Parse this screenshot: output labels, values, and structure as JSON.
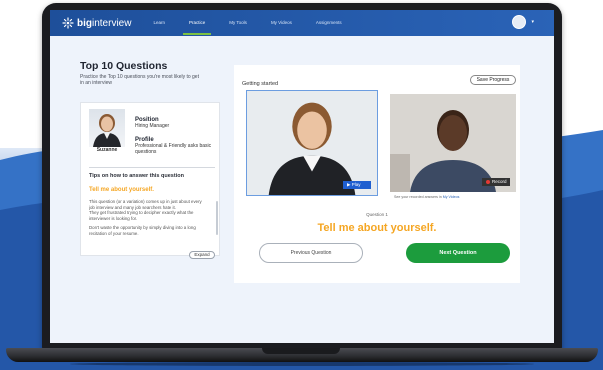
{
  "brand": {
    "logo_bold": "big",
    "logo_light": "interview"
  },
  "nav": {
    "items": [
      {
        "label": "Learn"
      },
      {
        "label": "Practice"
      },
      {
        "label": "My Tools"
      },
      {
        "label": "My Videos"
      },
      {
        "label": "Assignments"
      }
    ],
    "active": "Practice",
    "accent": "#7cc142"
  },
  "page": {
    "title": "Top 10 Questions",
    "intro": "Practice the Top 10 questions you're most likely to get in an interview"
  },
  "interviewer": {
    "name": "Suzanne",
    "position_label": "Position",
    "position_value": "Hiring Manager",
    "profile_label": "Profile",
    "profile_value": "Professional & Friendly asks basic questions"
  },
  "tips": {
    "heading": "Tips on how to answer this question",
    "question": "Tell me about yourself.",
    "body_1": "This question (or a variation) comes up in just about every job interview and many job searchers hate it.",
    "body_2": "They get frustrated trying to decipher exactly what the interviewer is looking for.",
    "body_3": "Don't waste the opportunity by simply diving into a long recitation of your resume.",
    "expand_label": "Expand"
  },
  "session": {
    "status": "Getting started",
    "save_label": "Save Progress",
    "play_label": "Play",
    "record_label": "Record",
    "recorded_note": "See your recorded answers in",
    "recorded_link": "My Videos",
    "question_number": "Question 1",
    "question_text": "Tell me about yourself.",
    "prev_label": "Previous Question",
    "next_label": "Next Question"
  },
  "colors": {
    "nav_bg": "#2a63b7",
    "question_orange": "#f5a623",
    "next_green": "#1c9c3d"
  }
}
